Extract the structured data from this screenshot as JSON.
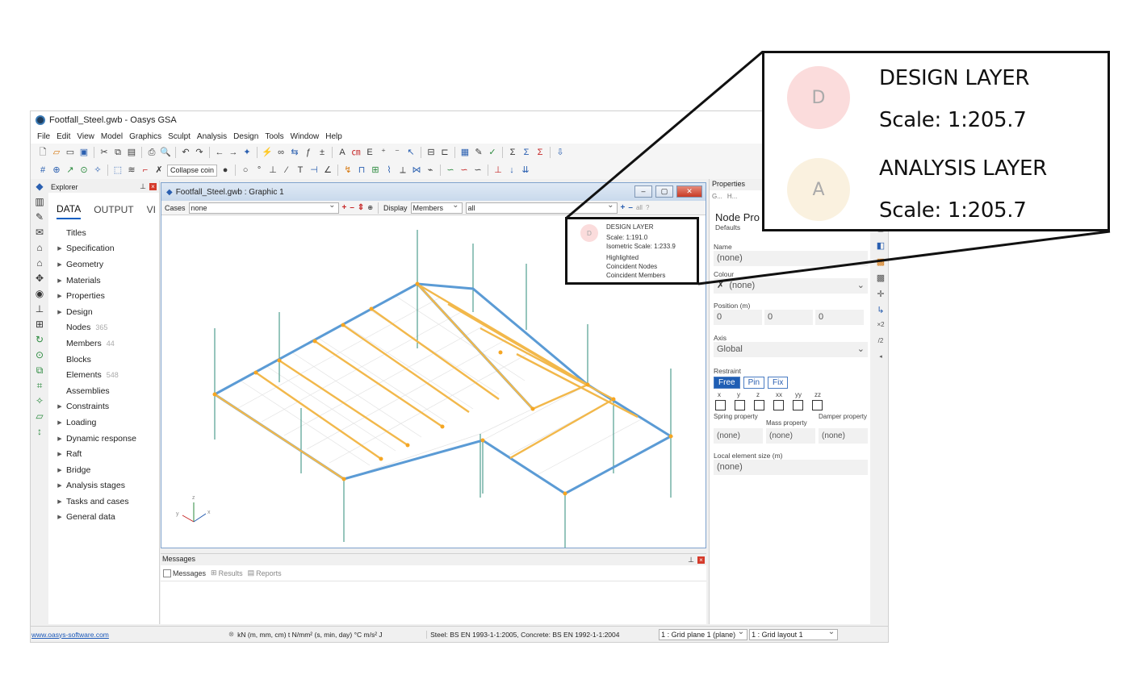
{
  "app": {
    "title": "Footfall_Steel.gwb - Oasys GSA",
    "menu": [
      "File",
      "Edit",
      "View",
      "Model",
      "Graphics",
      "Sculpt",
      "Analysis",
      "Design",
      "Tools",
      "Window",
      "Help"
    ],
    "toolbar2_dropdown": "Collapse coin"
  },
  "explorer": {
    "header": "Explorer",
    "tabs": [
      "DATA",
      "OUTPUT",
      "VI"
    ],
    "items": [
      {
        "label": "Titles",
        "arrow": false,
        "count": ""
      },
      {
        "label": "Specification",
        "arrow": true,
        "count": ""
      },
      {
        "label": "Geometry",
        "arrow": true,
        "count": ""
      },
      {
        "label": "Materials",
        "arrow": true,
        "count": ""
      },
      {
        "label": "Properties",
        "arrow": true,
        "count": ""
      },
      {
        "label": "Design",
        "arrow": true,
        "count": ""
      },
      {
        "label": "Nodes",
        "arrow": false,
        "count": "365"
      },
      {
        "label": "Members",
        "arrow": false,
        "count": "44"
      },
      {
        "label": "Blocks",
        "arrow": false,
        "count": ""
      },
      {
        "label": "Elements",
        "arrow": false,
        "count": "548"
      },
      {
        "label": "Assemblies",
        "arrow": false,
        "count": ""
      },
      {
        "label": "Constraints",
        "arrow": true,
        "count": ""
      },
      {
        "label": "Loading",
        "arrow": true,
        "count": ""
      },
      {
        "label": "Dynamic response",
        "arrow": true,
        "count": ""
      },
      {
        "label": "Raft",
        "arrow": true,
        "count": ""
      },
      {
        "label": "Bridge",
        "arrow": true,
        "count": ""
      },
      {
        "label": "Analysis stages",
        "arrow": true,
        "count": ""
      },
      {
        "label": "Tasks and cases",
        "arrow": true,
        "count": ""
      },
      {
        "label": "General data",
        "arrow": true,
        "count": ""
      }
    ]
  },
  "graphic": {
    "title": "Footfall_Steel.gwb : Graphic 1",
    "cases_label": "Cases",
    "cases_value": "none",
    "display_label": "Display",
    "display_value": "Members",
    "filter_value": "all",
    "all_label": "all",
    "axis_labels": {
      "z": "z",
      "y": "y",
      "x": "x"
    }
  },
  "legend_small": {
    "circle": "D",
    "lines": [
      "DESIGN LAYER",
      "Scale: 1:191.0",
      "Isometric Scale: 1:233.9",
      "Highlighted",
      "Coincident Nodes",
      "Coincident Members"
    ]
  },
  "legend_zoom": {
    "design_circle": "D",
    "design_title": "DESIGN LAYER",
    "design_scale": "Scale: 1:205.7",
    "analysis_circle": "A",
    "analysis_title": "ANALYSIS LAYER",
    "analysis_scale": "Scale: 1:205.7"
  },
  "messages": {
    "header": "Messages",
    "tabs": [
      "Messages",
      "Results",
      "Reports"
    ]
  },
  "properties": {
    "header": "Properties",
    "tab1": "G...",
    "tab2": "H...",
    "title": "Node Pro",
    "subtitle": "Defaults",
    "name_label": "Name",
    "name_value": "(none)",
    "colour_label": "Colour",
    "colour_value": "(none)",
    "position_label": "Position (m)",
    "position_values": [
      "0",
      "0",
      "0"
    ],
    "axis_label": "Axis",
    "axis_value": "Global",
    "restraint_label": "Restraint",
    "restraint_buttons": [
      "Free",
      "Pin",
      "Fix"
    ],
    "dof_labels": [
      "x",
      "y",
      "z",
      "xx",
      "yy",
      "zz"
    ],
    "spring_label": "Spring property",
    "mass_label": "Mass property",
    "damper_label": "Damper property",
    "spring_value": "(none)",
    "mass_value": "(none)",
    "damper_value": "(none)",
    "local_size_label": "Local element size (m)",
    "local_size_value": "(none)"
  },
  "status": {
    "link": "www.oasys-software.com",
    "units": "kN  (m, mm, cm)  t  N/mm²  (s, min, day)  °C  m/s²  J",
    "codes": "Steel: BS EN 1993-1-1:2005, Concrete: BS EN 1992-1-1:2004",
    "grid_plane": "1 : Grid plane 1 (plane)",
    "grid_layout": "1 : Grid layout 1"
  },
  "colors": {
    "beam_blue": "#5b9bd5",
    "beam_orange": "#f2b84b",
    "column_green": "#2e8b7a",
    "node_orange": "#f5a623",
    "design_circle": "#fbdcdc",
    "analysis_circle": "#faf1df"
  }
}
